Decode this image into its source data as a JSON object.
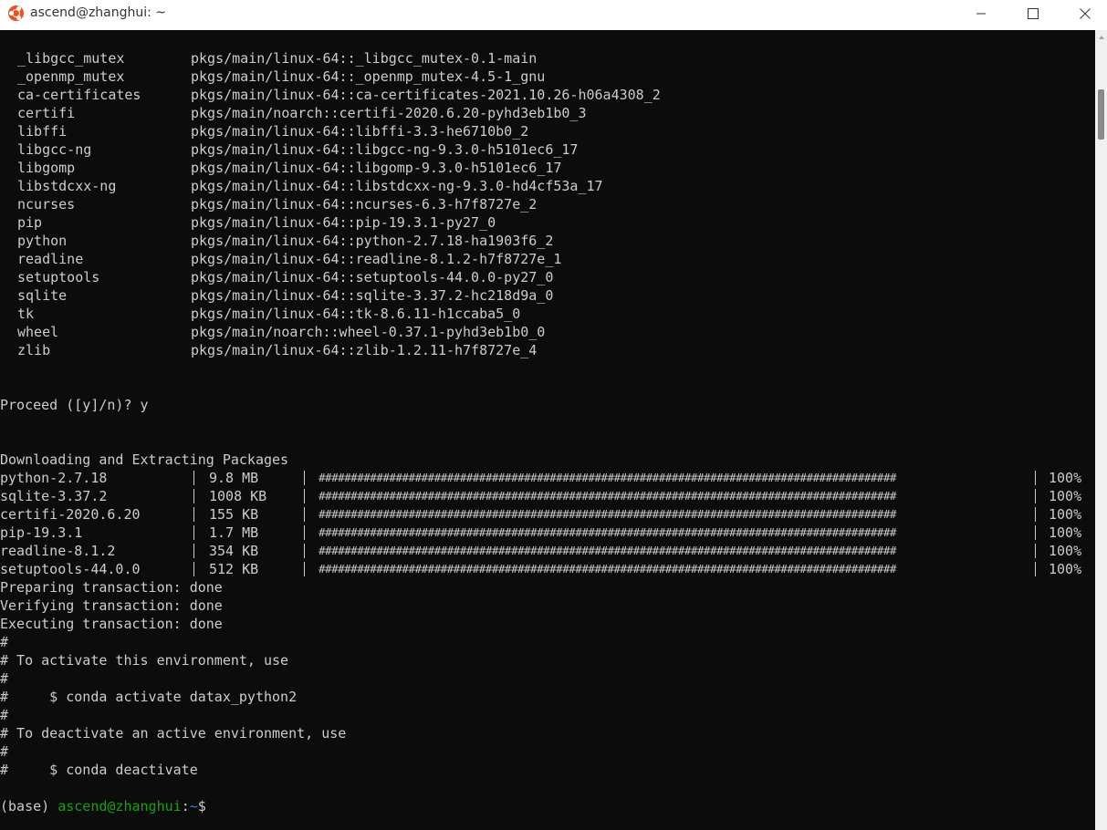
{
  "window": {
    "title": "ascend@zhanghui: ~",
    "icon": "ubuntu-logo-icon",
    "controls": [
      "minimize-icon",
      "maximize-icon",
      "close-icon"
    ]
  },
  "packages": [
    {
      "name": "_libgcc_mutex",
      "spec": "pkgs/main/linux-64::_libgcc_mutex-0.1-main"
    },
    {
      "name": "_openmp_mutex",
      "spec": "pkgs/main/linux-64::_openmp_mutex-4.5-1_gnu"
    },
    {
      "name": "ca-certificates",
      "spec": "pkgs/main/linux-64::ca-certificates-2021.10.26-h06a4308_2"
    },
    {
      "name": "certifi",
      "spec": "pkgs/main/noarch::certifi-2020.6.20-pyhd3eb1b0_3"
    },
    {
      "name": "libffi",
      "spec": "pkgs/main/linux-64::libffi-3.3-he6710b0_2"
    },
    {
      "name": "libgcc-ng",
      "spec": "pkgs/main/linux-64::libgcc-ng-9.3.0-h5101ec6_17"
    },
    {
      "name": "libgomp",
      "spec": "pkgs/main/linux-64::libgomp-9.3.0-h5101ec6_17"
    },
    {
      "name": "libstdcxx-ng",
      "spec": "pkgs/main/linux-64::libstdcxx-ng-9.3.0-hd4cf53a_17"
    },
    {
      "name": "ncurses",
      "spec": "pkgs/main/linux-64::ncurses-6.3-h7f8727e_2"
    },
    {
      "name": "pip",
      "spec": "pkgs/main/linux-64::pip-19.3.1-py27_0"
    },
    {
      "name": "python",
      "spec": "pkgs/main/linux-64::python-2.7.18-ha1903f6_2"
    },
    {
      "name": "readline",
      "spec": "pkgs/main/linux-64::readline-8.1.2-h7f8727e_1"
    },
    {
      "name": "setuptools",
      "spec": "pkgs/main/linux-64::setuptools-44.0.0-py27_0"
    },
    {
      "name": "sqlite",
      "spec": "pkgs/main/linux-64::sqlite-3.37.2-hc218d9a_0"
    },
    {
      "name": "tk",
      "spec": "pkgs/main/linux-64::tk-8.6.11-h1ccaba5_0"
    },
    {
      "name": "wheel",
      "spec": "pkgs/main/noarch::wheel-0.37.1-pyhd3eb1b0_0"
    },
    {
      "name": "zlib",
      "spec": "pkgs/main/linux-64::zlib-1.2.11-h7f8727e_4"
    }
  ],
  "proceed_prompt": "Proceed ([y]/n)? y",
  "downloading_header": "Downloading and Extracting Packages",
  "downloads": [
    {
      "name": "python-2.7.18",
      "size": "9.8 MB",
      "bar": "##########################################################################################",
      "percent": "100%"
    },
    {
      "name": "sqlite-3.37.2",
      "size": "1008 KB",
      "bar": "##########################################################################################",
      "percent": "100%"
    },
    {
      "name": "certifi-2020.6.20",
      "size": "155 KB",
      "bar": "##########################################################################################",
      "percent": "100%"
    },
    {
      "name": "pip-19.3.1",
      "size": "1.7 MB",
      "bar": "##########################################################################################",
      "percent": "100%"
    },
    {
      "name": "readline-8.1.2",
      "size": "354 KB",
      "bar": "##########################################################################################",
      "percent": "100%"
    },
    {
      "name": "setuptools-44.0.0",
      "size": "512 KB",
      "bar": "##########################################################################################",
      "percent": "100%"
    }
  ],
  "status_lines": [
    "Preparing transaction: done",
    "Verifying transaction: done",
    "Executing transaction: done"
  ],
  "activation_notes": [
    "#",
    "# To activate this environment, use",
    "#",
    "#     $ conda activate datax_python2",
    "#",
    "# To deactivate an active environment, use",
    "#",
    "#     $ conda deactivate"
  ],
  "prompt": {
    "env": "(base) ",
    "user_host": "ascend@zhanghui",
    "colon": ":",
    "path": "~",
    "symbol": "$"
  },
  "colors": {
    "terminal_bg": "#0c0c0c",
    "terminal_fg": "#cccccc",
    "prompt_user": "#13a10e",
    "prompt_path": "#3b78ff"
  }
}
